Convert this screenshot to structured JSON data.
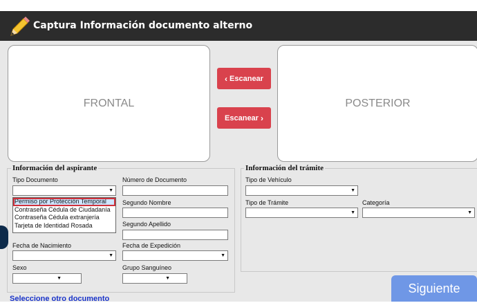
{
  "window": {
    "title": "Captura Información documento alterno",
    "icon": "pencil-icon"
  },
  "scan": {
    "front_label": "FRONTAL",
    "back_label": "POSTERIOR",
    "scan_left_label": "Escanear",
    "scan_right_label": "Escanear",
    "button_color": "#d9424d"
  },
  "aspirante": {
    "legend": "Información del aspirante",
    "tipo_documento": {
      "label": "Tipo Documento",
      "value": ""
    },
    "dropdown_options": [
      "Permiso por Protección Temporal",
      "Contraseña Cédula de Ciudadanía",
      "Contraseña Cédula extranjería",
      "Tarjeta de Identidad Rosada"
    ],
    "dropdown_selected_index": 0,
    "numero_documento": {
      "label": "Número de Documento",
      "value": ""
    },
    "segundo_nombre": {
      "label": "Segundo Nombre",
      "value": ""
    },
    "segundo_apellido": {
      "label": "Segundo Apellido",
      "value": ""
    },
    "fecha_nacimiento": {
      "label": "Fecha de Nacimiento",
      "value": ""
    },
    "fecha_expedicion": {
      "label": "Fecha de Expedición",
      "value": ""
    },
    "sexo": {
      "label": "Sexo",
      "value": ""
    },
    "grupo_sanguineo": {
      "label": "Grupo Sanguíneo",
      "value": ""
    }
  },
  "tramite": {
    "legend": "Información del trámite",
    "tipo_vehiculo": {
      "label": "Tipo de Vehículo",
      "value": ""
    },
    "tipo_tramite": {
      "label": "Tipo de Trámite",
      "value": ""
    },
    "categoria": {
      "label": "Categoría",
      "value": ""
    }
  },
  "footer": {
    "siguiente_label": "Siguiente",
    "otro_documento_link": "Seleccione otro documento",
    "siguiente_color": "#6f97e6"
  }
}
